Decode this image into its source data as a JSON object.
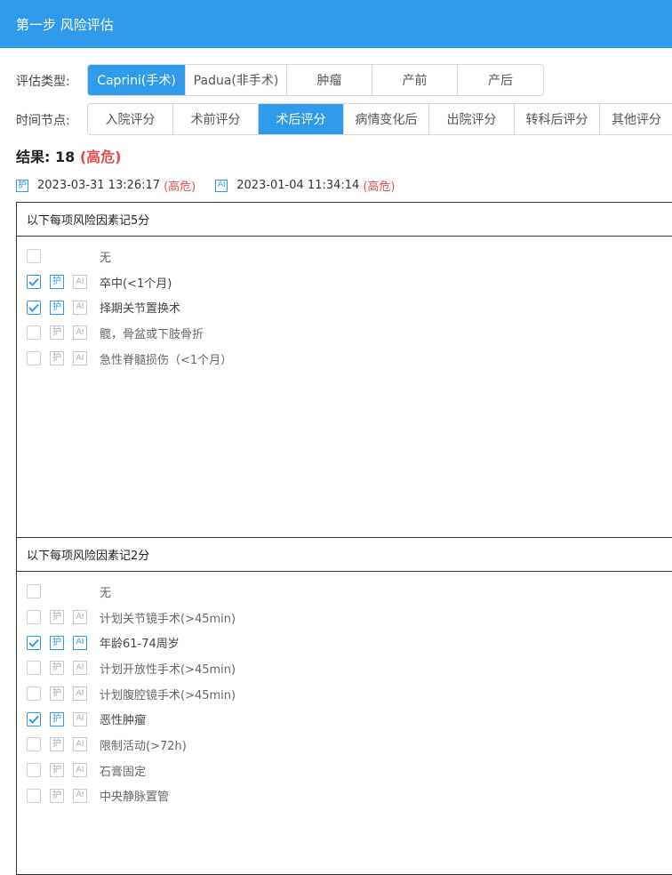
{
  "header": {
    "title": "第一步 风险评估"
  },
  "assessment_type": {
    "label": "评估类型:",
    "options": [
      "Caprini(手术)",
      "Padua(非手术)",
      "肿瘤",
      "产前",
      "产后"
    ],
    "selected": "Caprini(手术)"
  },
  "time_point": {
    "label": "时间节点:",
    "options": [
      "入院评分",
      "术前评分",
      "术后评分",
      "病情变化后",
      "出院评分",
      "转科后评分",
      "其他评分"
    ],
    "selected": "术后评分"
  },
  "result": {
    "label": "结果:",
    "score": "18",
    "risk": "(高危)"
  },
  "sources": [
    {
      "badge": "护",
      "timestamp": "2023-03-31 13:26:17",
      "risk": "(高危)"
    },
    {
      "badge": "AI",
      "timestamp": "2023-01-04 11:34:14",
      "risk": "(高危)"
    }
  ],
  "icons": {
    "nurse": "护",
    "ai": "AI"
  },
  "colors": {
    "accent": "#2f9bea",
    "risk": "#e34d4d"
  },
  "sections": [
    {
      "title": "以下每项风险因素记5分",
      "items": [
        {
          "label": "无",
          "checked": false,
          "has_tags": false,
          "tags_active": false
        },
        {
          "label": "卒中(<1个月)",
          "checked": true,
          "has_tags": true,
          "tags_active": false
        },
        {
          "label": "择期关节置换术",
          "checked": true,
          "has_tags": true,
          "tags_active": false
        },
        {
          "label": "髋，骨盆或下肢骨折",
          "checked": false,
          "has_tags": true,
          "tags_active": false
        },
        {
          "label": "急性脊髓损伤（<1个月）",
          "checked": false,
          "has_tags": true,
          "tags_active": false
        }
      ]
    },
    {
      "title": "以下每项风险因素记2分",
      "items": [
        {
          "label": "无",
          "checked": false,
          "has_tags": false,
          "tags_active": false
        },
        {
          "label": "计划关节镜手术(>45min)",
          "checked": false,
          "has_tags": true,
          "tags_active": false
        },
        {
          "label": "年龄61-74周岁",
          "checked": true,
          "has_tags": true,
          "tags_active": true
        },
        {
          "label": "计划开放性手术(>45min)",
          "checked": false,
          "has_tags": true,
          "tags_active": false
        },
        {
          "label": "计划腹腔镜手术(>45min)",
          "checked": false,
          "has_tags": true,
          "tags_active": false
        },
        {
          "label": "恶性肿瘤",
          "checked": true,
          "has_tags": true,
          "tags_active": false
        },
        {
          "label": "限制活动(>72h)",
          "checked": false,
          "has_tags": true,
          "tags_active": false
        },
        {
          "label": "石膏固定",
          "checked": false,
          "has_tags": true,
          "tags_active": false
        },
        {
          "label": "中央静脉置管",
          "checked": false,
          "has_tags": true,
          "tags_active": false
        }
      ]
    }
  ]
}
